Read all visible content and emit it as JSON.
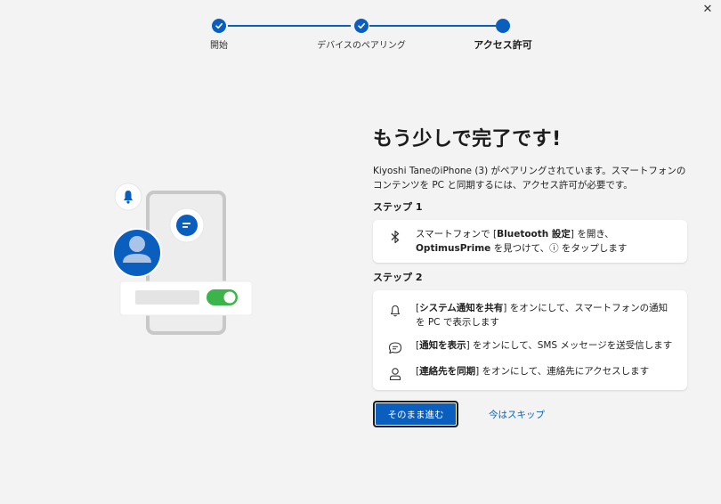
{
  "window": {
    "close_glyph": "✕"
  },
  "stepper": {
    "steps": [
      {
        "label": "開始",
        "state": "done"
      },
      {
        "label": "デバイスのペアリング",
        "state": "done"
      },
      {
        "label": "アクセス許可",
        "state": "current"
      }
    ]
  },
  "main": {
    "title": "もう少しで完了です!",
    "description": "Kiyoshi TaneのiPhone (3) がペアリングされています。スマートフォンのコンテンツを PC と同期するには、アクセス許可が必要です。",
    "step1": {
      "heading": "ステップ 1",
      "icon": "bluetooth-icon",
      "text_pre": "スマートフォンで [",
      "text_bold1": "Bluetooth 設定",
      "text_mid": "] を開き、",
      "text_bold2": "OptimusPrime",
      "text_post": " を見つけて、ⓘ をタップします"
    },
    "step2": {
      "heading": "ステップ 2",
      "rows": [
        {
          "icon": "bell-icon",
          "open": "[",
          "bold": "システム通知を共有",
          "rest": "] をオンにして、スマートフォンの通知を PC で表示します"
        },
        {
          "icon": "message-icon",
          "open": "[",
          "bold": "通知を表示",
          "rest": "] をオンにして、SMS メッセージを送受信します"
        },
        {
          "icon": "person-icon",
          "open": "[",
          "bold": "連絡先を同期",
          "rest": "] をオンにして、連絡先にアクセスします"
        }
      ]
    },
    "actions": {
      "primary": "そのまま進む",
      "skip": "今はスキップ"
    }
  },
  "colors": {
    "accent": "#0a5fbe",
    "toggle": "#3bb54a",
    "background": "#f3f3f3"
  }
}
